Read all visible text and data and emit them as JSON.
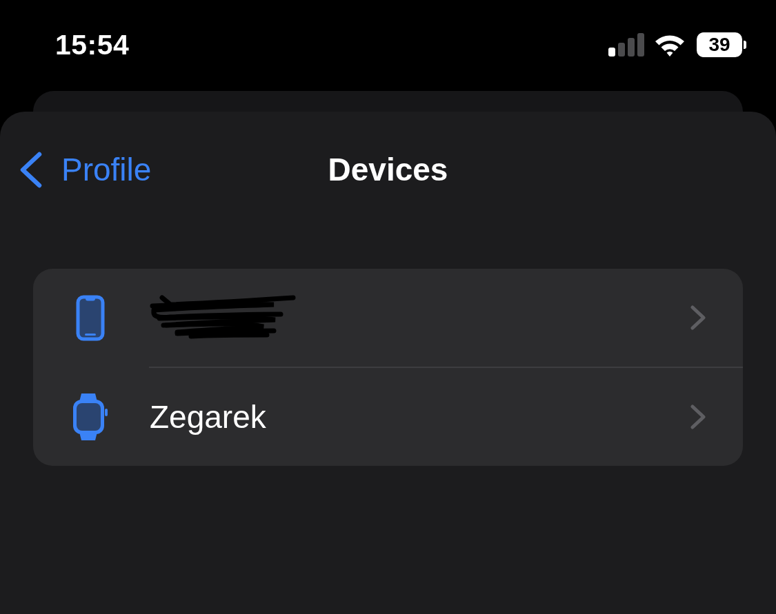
{
  "status_bar": {
    "time": "15:54",
    "battery": "39"
  },
  "nav_bar": {
    "back_label": "Profile",
    "title": "Devices"
  },
  "devices": [
    {
      "kind": "phone",
      "redacted": true
    },
    {
      "kind": "watch",
      "redacted": false,
      "name": "Zegarek"
    }
  ]
}
